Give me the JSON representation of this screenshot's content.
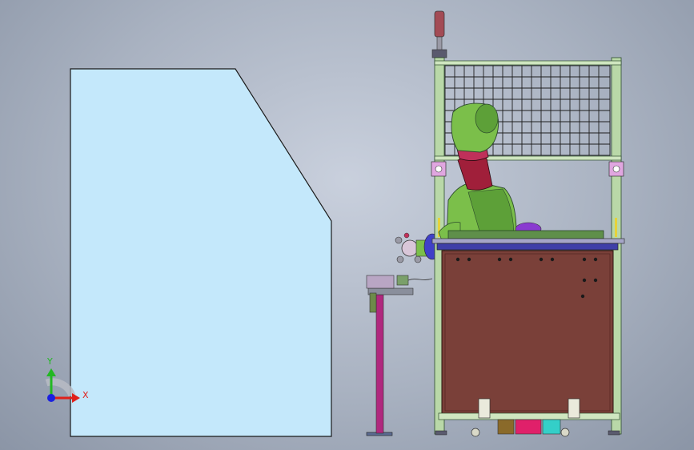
{
  "viewport": {
    "background_top": "#c9d0dd",
    "background_bottom": "#8b95a6"
  },
  "triad": {
    "x_label": "X",
    "y_label": "Y",
    "x_color": "#e0201a",
    "y_color": "#22b822",
    "z_color": "#1a20e0"
  },
  "colors": {
    "panel_face": "#c4e8fb",
    "cabinet": "#7a4039",
    "frame_post": "#b9d8a8",
    "robot_green": "#7bbf4a",
    "robot_red": "#a01f3a",
    "table_blue": "#3f3fa8",
    "stand_magenta": "#b0287e"
  }
}
